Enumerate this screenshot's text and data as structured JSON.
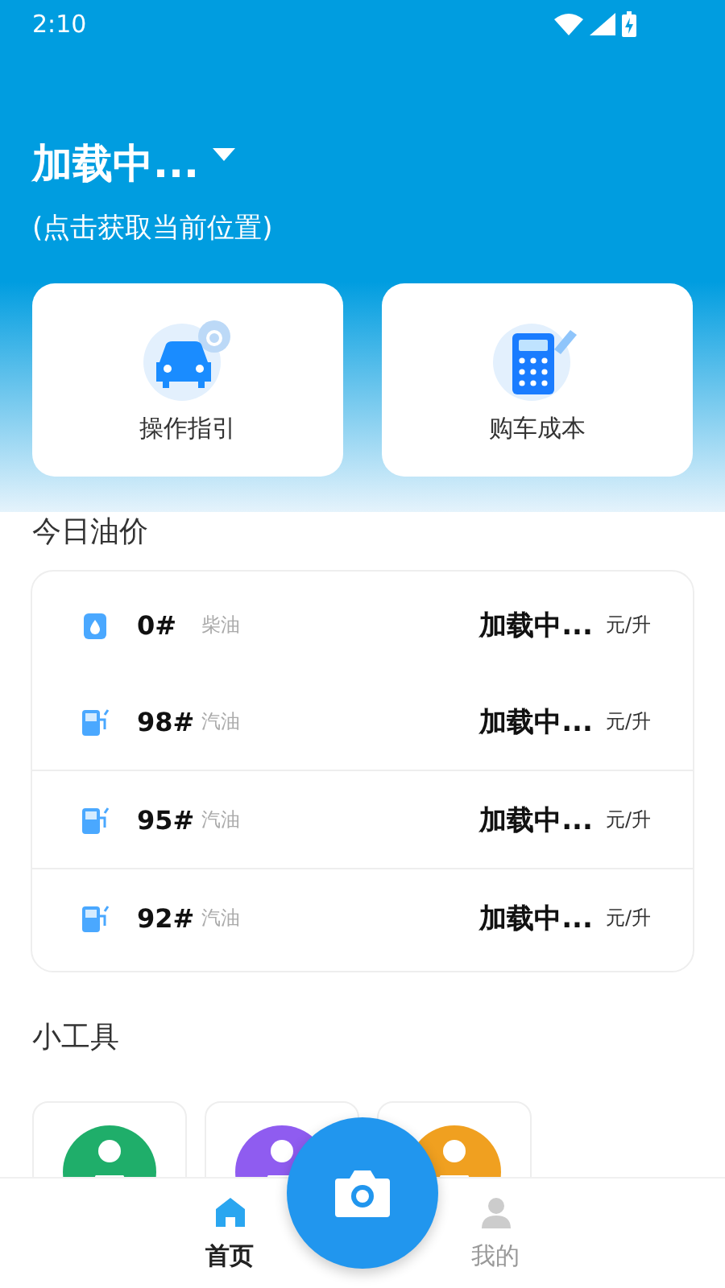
{
  "status_bar": {
    "time": "2:10"
  },
  "location": {
    "title": "加载中...",
    "hint": "(点击获取当前位置)"
  },
  "shortcuts": [
    {
      "label": "操作指引",
      "kind": "car"
    },
    {
      "label": "购车成本",
      "kind": "calculator"
    }
  ],
  "prices": {
    "title": "今日油价",
    "rows": [
      {
        "grade": "0#",
        "type": "柴油",
        "kind": "diesel",
        "price": "加载中...",
        "unit": "元/升"
      },
      {
        "grade": "98#",
        "type": "汽油",
        "kind": "gasoline",
        "price": "加载中...",
        "unit": "元/升"
      },
      {
        "grade": "95#",
        "type": "汽油",
        "kind": "gasoline",
        "price": "加载中...",
        "unit": "元/升"
      },
      {
        "grade": "92#",
        "type": "汽油",
        "kind": "gasoline",
        "price": "加载中...",
        "unit": "元/升"
      }
    ]
  },
  "tools": {
    "title": "小工具",
    "items": [
      {
        "color": "#1fae6a"
      },
      {
        "color": "#8f5cf0"
      },
      {
        "color": "#f0a020"
      }
    ]
  },
  "tabs": [
    {
      "label": "首页",
      "selected": true
    },
    {
      "label": "我的",
      "selected": false
    }
  ]
}
